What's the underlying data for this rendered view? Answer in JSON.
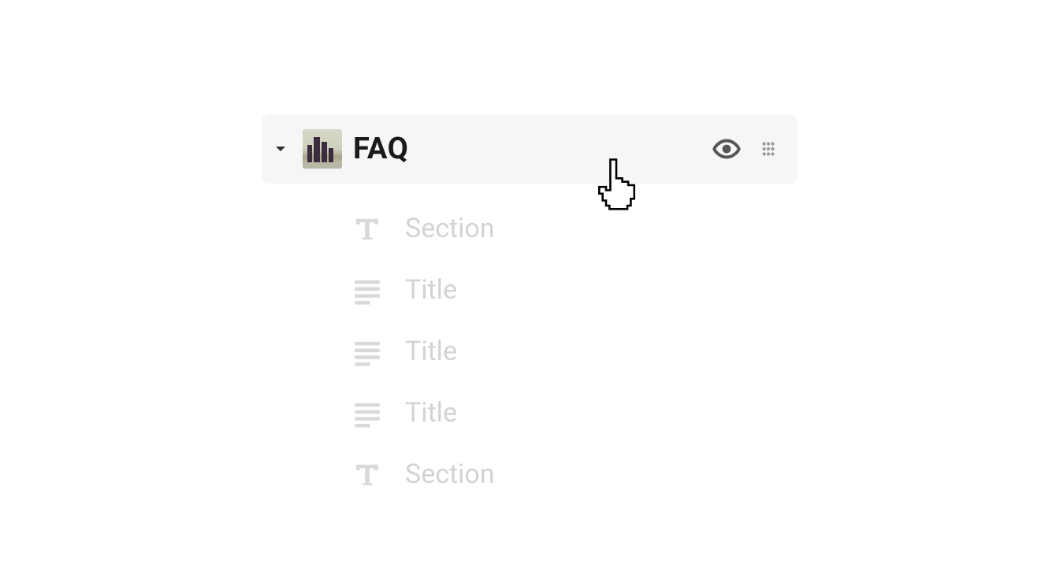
{
  "header": {
    "title": "FAQ"
  },
  "items": [
    {
      "type": "section",
      "label": "Section"
    },
    {
      "type": "title",
      "label": "Title"
    },
    {
      "type": "title",
      "label": "Title"
    },
    {
      "type": "title",
      "label": "Title"
    },
    {
      "type": "section",
      "label": "Section"
    }
  ]
}
